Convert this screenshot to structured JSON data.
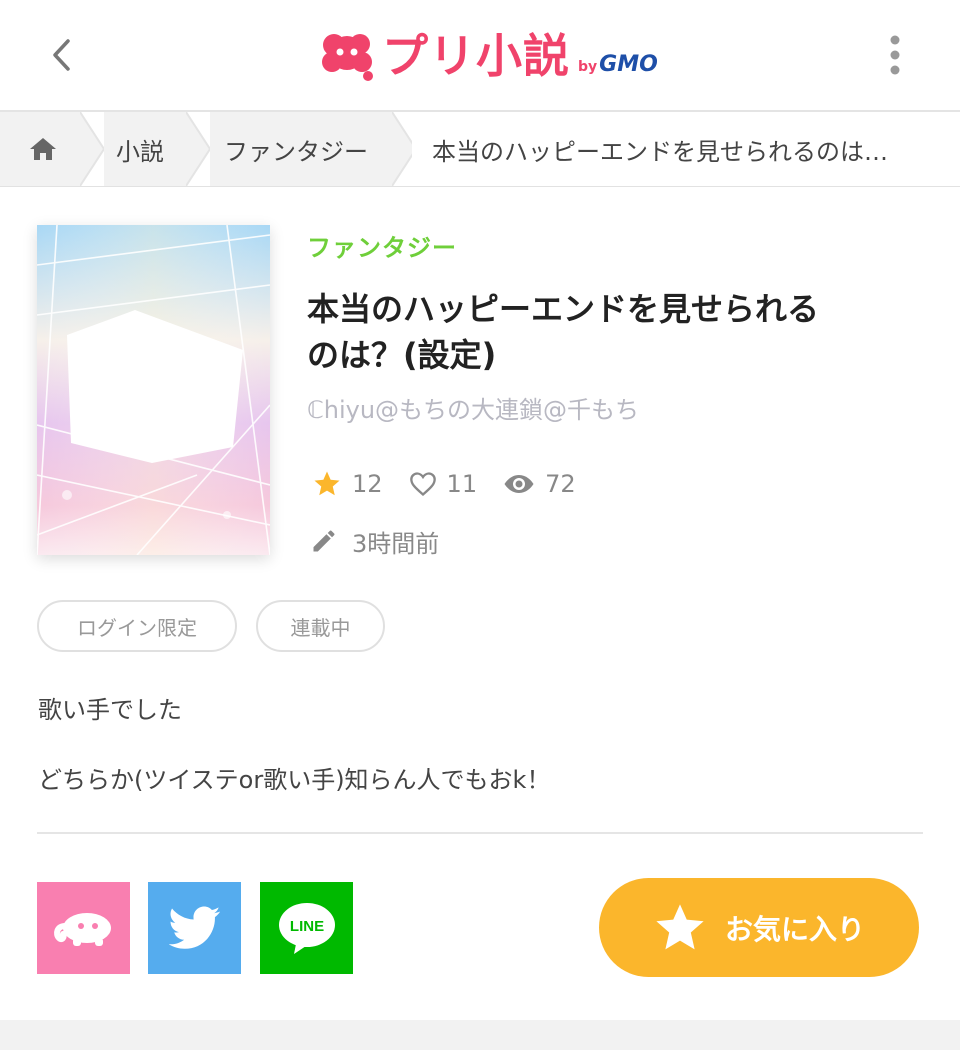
{
  "header": {
    "logo_text": "プリ小説",
    "logo_by": "by",
    "logo_gmo": "GMO"
  },
  "breadcrumb": {
    "home_icon": "home-icon",
    "items": [
      "小説",
      "ファンタジー",
      "本当のハッピーエンドを見せられるのは…"
    ]
  },
  "work": {
    "genre": "ファンタジー",
    "title_line1": "本当のハッピーエンドを見せられる",
    "title_line2": "のは？(設定)",
    "author": "ℂhiyu@もちの大連鎖@千もち",
    "stats": {
      "stars": "12",
      "likes": "11",
      "views": "72"
    },
    "updated": "3時間前"
  },
  "tags": [
    "ログイン限定",
    "連載中"
  ],
  "description": [
    "歌い手でした",
    "どちらか(ツイステor歌い手)知らん人でもおk！"
  ],
  "share": {
    "line_label": "LINE"
  },
  "favorite_button": {
    "label": "お気に入り"
  },
  "colors": {
    "brand": "#f0436b",
    "genre": "#6fcf3a",
    "favorite": "#fbb62c",
    "share_pri": "#f97fb0",
    "share_twitter": "#55acee",
    "share_line": "#00b900"
  }
}
